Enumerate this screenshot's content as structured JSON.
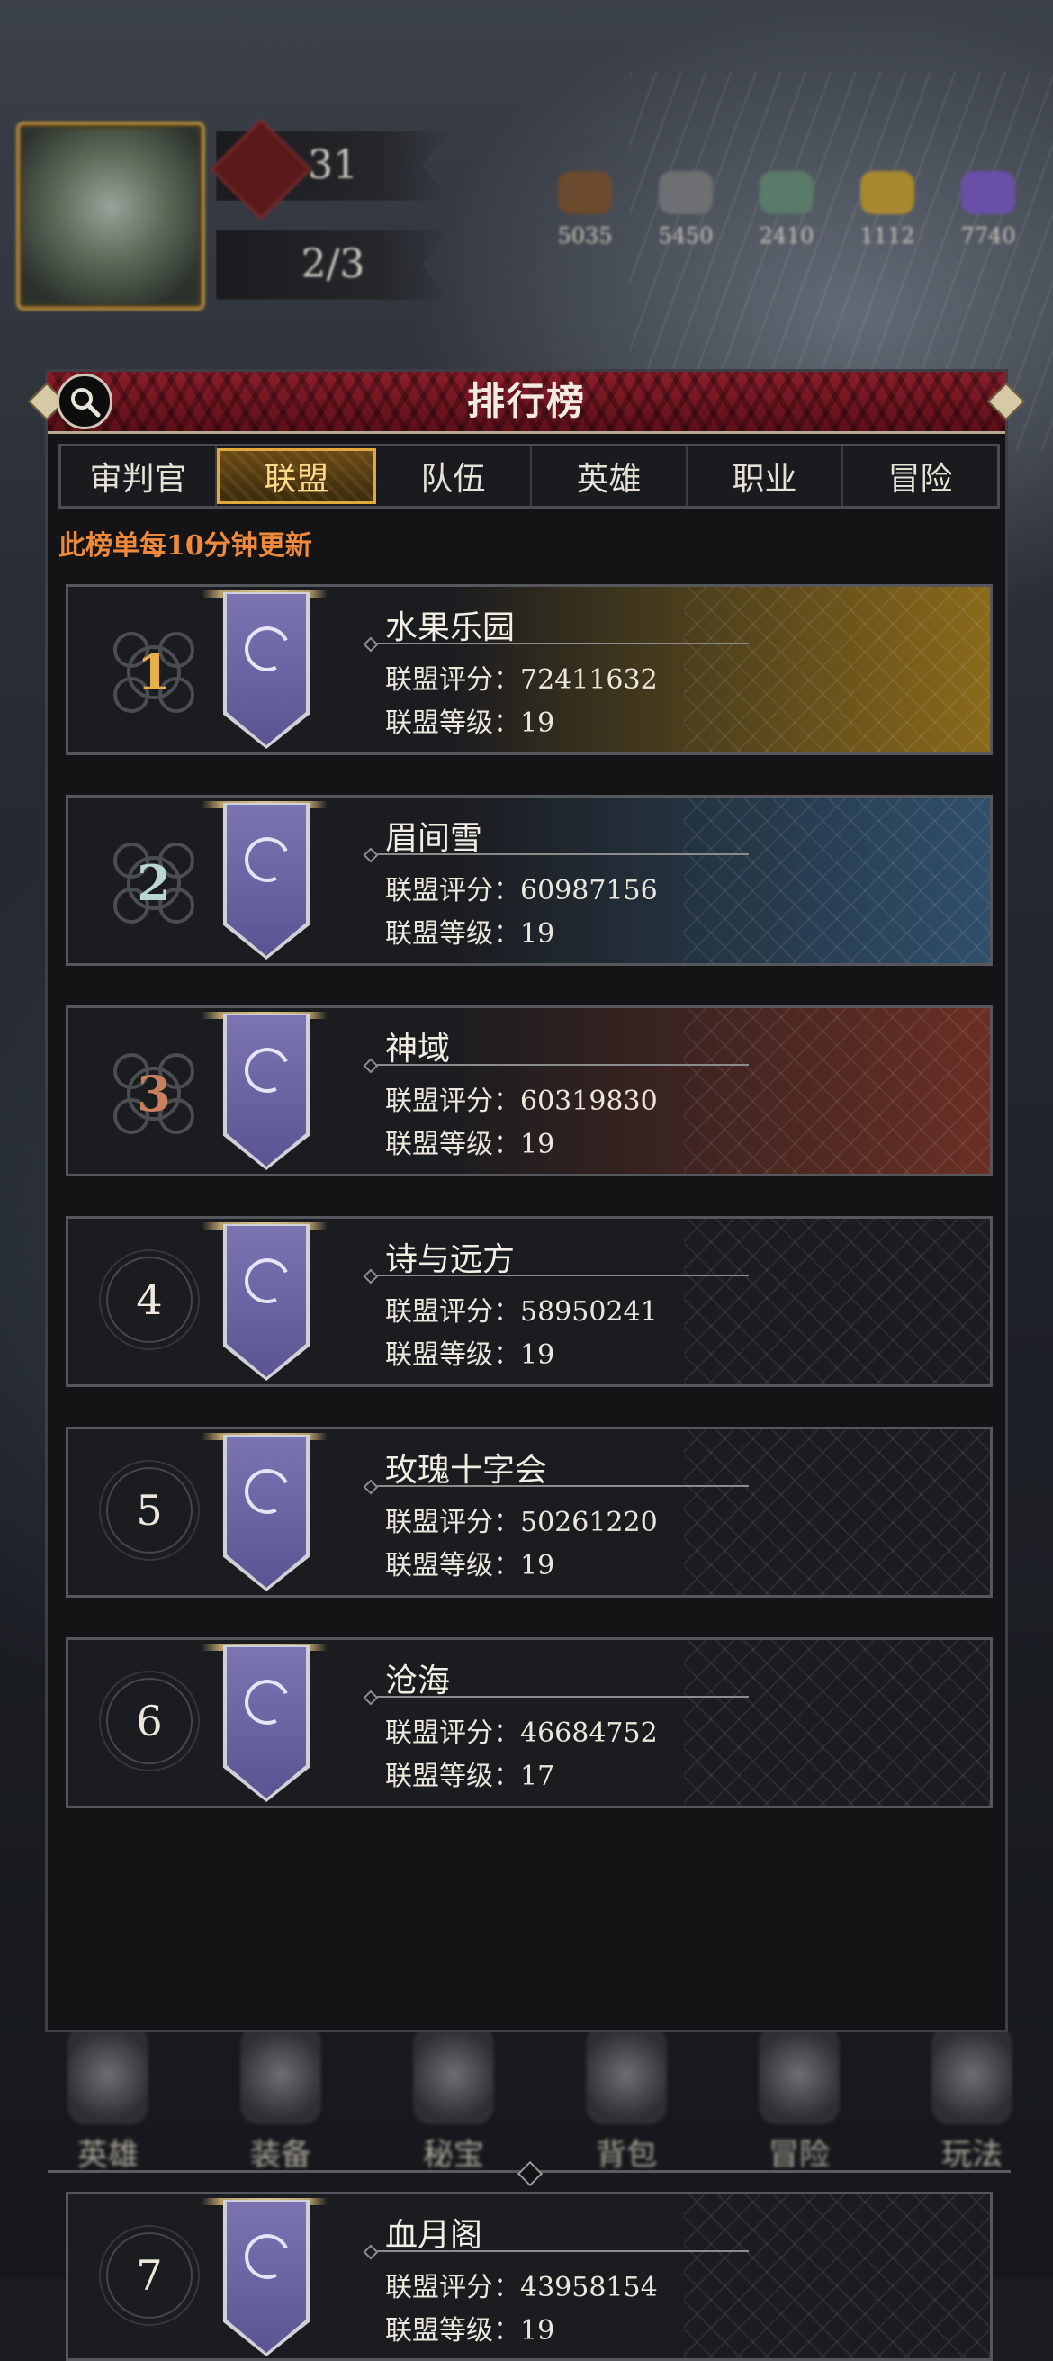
{
  "hud": {
    "level": "31",
    "stamina": "2/3",
    "resources": [
      {
        "icon": "wood-resource-icon",
        "value": "5035",
        "color": "#6b4a2e"
      },
      {
        "icon": "ore-resource-icon",
        "value": "5450",
        "color": "#6d6f73"
      },
      {
        "icon": "herb-resource-icon",
        "value": "2410",
        "color": "#5a7a6a"
      },
      {
        "icon": "gold-resource-icon",
        "value": "1112",
        "color": "#a88830"
      },
      {
        "icon": "crystal-resource-icon",
        "value": "7740",
        "color": "#6a4fa8"
      }
    ]
  },
  "bottom_nav": [
    {
      "label": "英雄"
    },
    {
      "label": "装备"
    },
    {
      "label": "秘宝"
    },
    {
      "label": "背包"
    },
    {
      "label": "冒险"
    },
    {
      "label": "玩法"
    }
  ],
  "panel": {
    "title": "排行榜",
    "tabs": [
      {
        "label": "审判官",
        "active": false
      },
      {
        "label": "联盟",
        "active": true
      },
      {
        "label": "队伍",
        "active": false
      },
      {
        "label": "英雄",
        "active": false
      },
      {
        "label": "职业",
        "active": false
      },
      {
        "label": "冒险",
        "active": false
      }
    ],
    "notice": "此榜单每10分钟更新",
    "score_label": "联盟评分：",
    "level_label": "联盟等级：",
    "rows": [
      {
        "rank": "1",
        "name": "水果乐园",
        "score": "72411632",
        "level": "19",
        "tint": "#8a6a1a",
        "rank_color": "#e8b04a"
      },
      {
        "rank": "2",
        "name": "眉间雪",
        "score": "60987156",
        "level": "19",
        "tint": "#2f4f6a",
        "rank_color": "#b9d6d6"
      },
      {
        "rank": "3",
        "name": "神域",
        "score": "60319830",
        "level": "19",
        "tint": "#6a2f24",
        "rank_color": "#c9805e"
      },
      {
        "rank": "4",
        "name": "诗与远方",
        "score": "58950241",
        "level": "19"
      },
      {
        "rank": "5",
        "name": "玫瑰十字会",
        "score": "50261220",
        "level": "19"
      },
      {
        "rank": "6",
        "name": "沧海",
        "score": "46684752",
        "level": "17"
      },
      {
        "rank": "7",
        "name": "血月阁",
        "score": "43958154",
        "level": "19"
      }
    ]
  }
}
